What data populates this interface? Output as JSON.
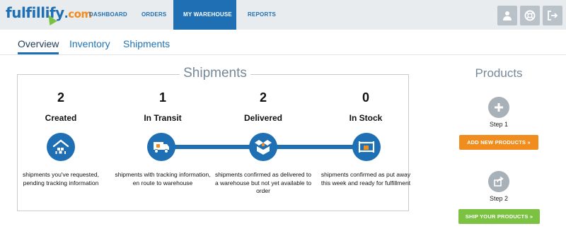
{
  "brand": {
    "name": "fulfillify",
    "dot": ".",
    "tld": "com"
  },
  "nav": {
    "items": [
      {
        "label": "DASHBOARD"
      },
      {
        "label": "ORDERS"
      },
      {
        "label": "MY WAREHOUSE",
        "active": true
      },
      {
        "label": "REPORTS"
      }
    ]
  },
  "header_icons": [
    "user-icon",
    "help-lifebuoy-icon",
    "logout-icon"
  ],
  "subnav": {
    "tabs": [
      {
        "label": "Overview",
        "active": true
      },
      {
        "label": "Inventory"
      },
      {
        "label": "Shipments"
      }
    ]
  },
  "shipments": {
    "title": "Shipments",
    "stages": [
      {
        "count": "2",
        "label": "Created",
        "icon": "warehouse-home-icon",
        "description": "shipments you've requested, pending tracking information"
      },
      {
        "count": "1",
        "label": "In Transit",
        "icon": "delivery-truck-icon",
        "description": "shipments with tracking information, en route to warehouse"
      },
      {
        "count": "2",
        "label": "Delivered",
        "icon": "open-box-icon",
        "description": "shipments confirmed as delivered to a warehouse but not yet available to order"
      },
      {
        "count": "0",
        "label": "In Stock",
        "icon": "pallet-shelf-icon",
        "description": "shipments confirmed as put away this week and ready for fulfillment"
      }
    ]
  },
  "products": {
    "title": "Products",
    "step1": {
      "label": "Step 1",
      "button": "ADD NEW PRODUCTS »",
      "icon": "plus-icon"
    },
    "step2": {
      "label": "Step 2",
      "button": "SHIP YOUR PRODUCTS »",
      "icon": "share-icon"
    }
  },
  "colors": {
    "brand_blue": "#1e6fb3",
    "orange": "#f18c1e",
    "green": "#7cc242",
    "gray": "#a8b0b8"
  }
}
